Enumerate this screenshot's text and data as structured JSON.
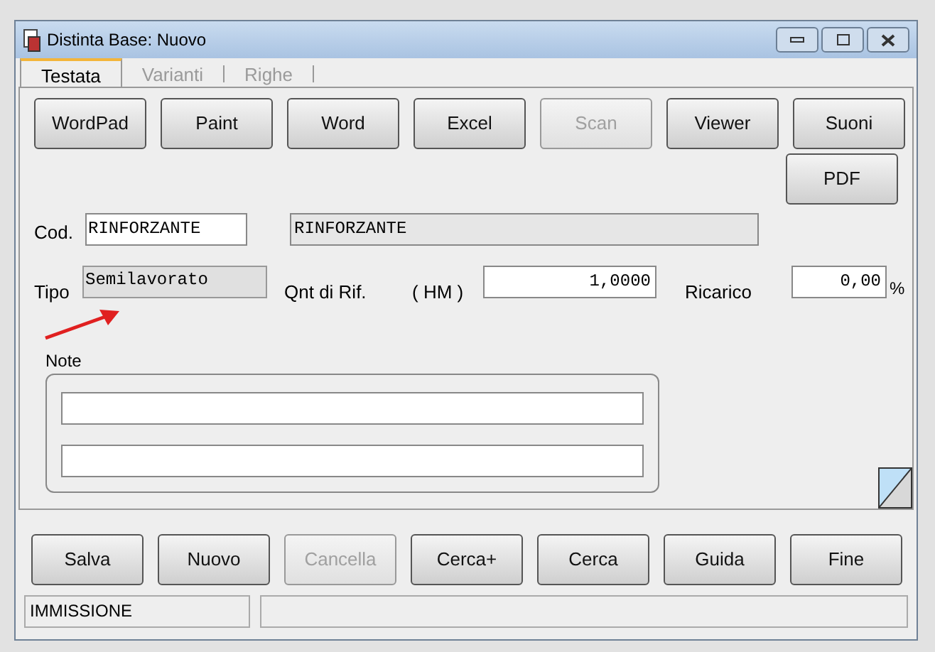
{
  "window": {
    "title": "Distinta Base: Nuovo"
  },
  "tabs": [
    {
      "label": "Testata",
      "selected": true
    },
    {
      "label": "Varianti",
      "selected": false
    },
    {
      "label": "Righe",
      "selected": false
    }
  ],
  "tools": [
    {
      "label": "WordPad",
      "disabled": false
    },
    {
      "label": "Paint",
      "disabled": false
    },
    {
      "label": "Word",
      "disabled": false
    },
    {
      "label": "Excel",
      "disabled": false
    },
    {
      "label": "Scan",
      "disabled": true
    },
    {
      "label": "Viewer",
      "disabled": false
    },
    {
      "label": "Suoni",
      "disabled": false
    },
    {
      "label": "PDF",
      "disabled": false
    }
  ],
  "cod": {
    "label": "Cod.",
    "value": "RINFORZANTE",
    "description": "RINFORZANTE"
  },
  "tipo": {
    "label": "Tipo",
    "value": "Semilavorato"
  },
  "qnt": {
    "label": "Qnt di Rif.",
    "unit": "( HM )",
    "value": "1,0000"
  },
  "ricarico": {
    "label": "Ricarico",
    "value": "0,00",
    "suffix": "%"
  },
  "note": {
    "label": "Note"
  },
  "actions": [
    {
      "label": "Salva",
      "disabled": false
    },
    {
      "label": "Nuovo",
      "disabled": false
    },
    {
      "label": "Cancella",
      "disabled": true
    },
    {
      "label": "Cerca+",
      "disabled": false
    },
    {
      "label": "Cerca",
      "disabled": false
    },
    {
      "label": "Guida",
      "disabled": false
    },
    {
      "label": "Fine",
      "disabled": false
    }
  ],
  "status_bar": {
    "mode": "IMMISSIONE"
  }
}
